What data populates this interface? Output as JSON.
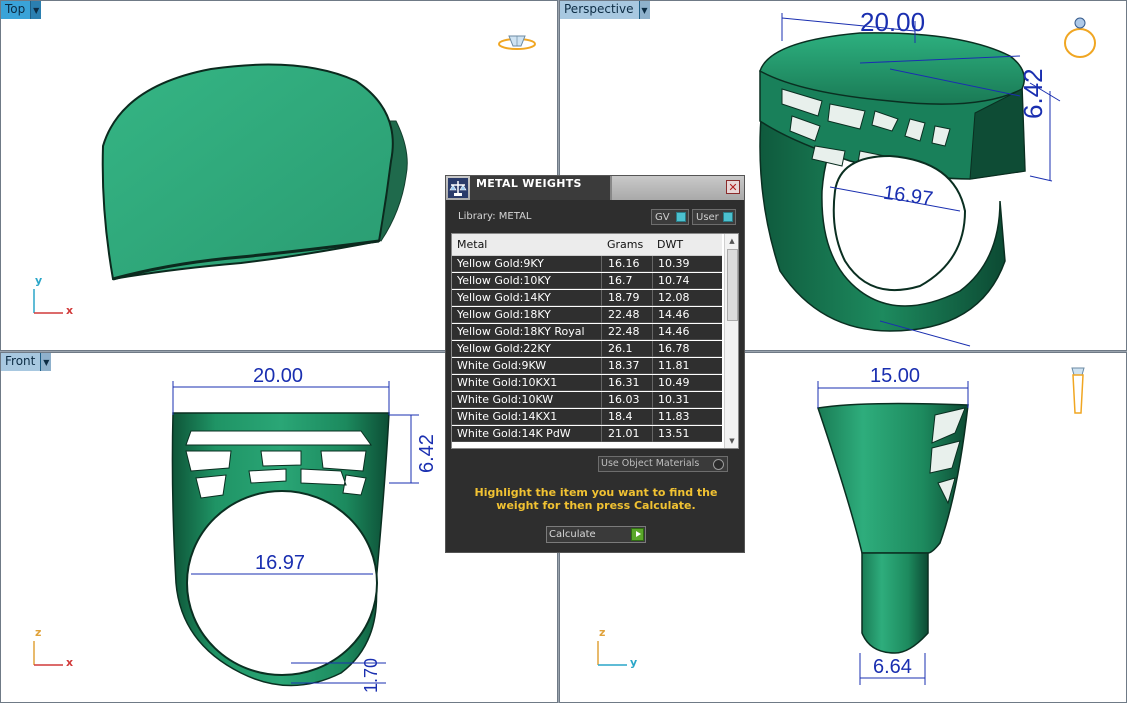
{
  "viewports": {
    "top": {
      "label": "Top",
      "axis_a": "y",
      "axis_b": "x"
    },
    "perspective": {
      "label": "Perspective",
      "dims": [
        "20.00",
        "6.42",
        "16.97"
      ]
    },
    "front": {
      "label": "Front",
      "axis_a": "z",
      "axis_b": "x",
      "dims": [
        "20.00",
        "6.42",
        "16.97",
        "1.70"
      ]
    },
    "right": {
      "axis_a": "z",
      "axis_b": "y",
      "dims": [
        "15.00",
        "6.64"
      ]
    }
  },
  "panel": {
    "title": "METAL WEIGHTS",
    "close": "✕",
    "library": "Library: METAL",
    "toggle_gv": "GV",
    "toggle_user": "User",
    "columns": [
      "Metal",
      "Grams",
      "DWT"
    ],
    "rows": [
      [
        "Yellow Gold:9KY",
        "16.16",
        "10.39"
      ],
      [
        "Yellow Gold:10KY",
        "16.7",
        "10.74"
      ],
      [
        "Yellow Gold:14KY",
        "18.79",
        "12.08"
      ],
      [
        "Yellow Gold:18KY",
        "22.48",
        "14.46"
      ],
      [
        "Yellow Gold:18KY Royal",
        "22.48",
        "14.46"
      ],
      [
        "Yellow Gold:22KY",
        "26.1",
        "16.78"
      ],
      [
        "White Gold:9KW",
        "18.37",
        "11.81"
      ],
      [
        "White Gold:10KX1",
        "16.31",
        "10.49"
      ],
      [
        "White Gold:10KW",
        "16.03",
        "10.31"
      ],
      [
        "White Gold:14KX1",
        "18.4",
        "11.83"
      ],
      [
        "White Gold:14K PdW",
        "21.01",
        "13.51"
      ]
    ],
    "use_object_materials": "Use Object Materials",
    "hint": "Highlight the item you want to find the weight for then press Calculate.",
    "calculate": "Calculate"
  },
  "colors": {
    "ring_green": "#2ea87a",
    "dim_blue": "#1a2fb0",
    "hint_yellow": "#f1c232",
    "tab_blue": "#3aa3d8"
  }
}
